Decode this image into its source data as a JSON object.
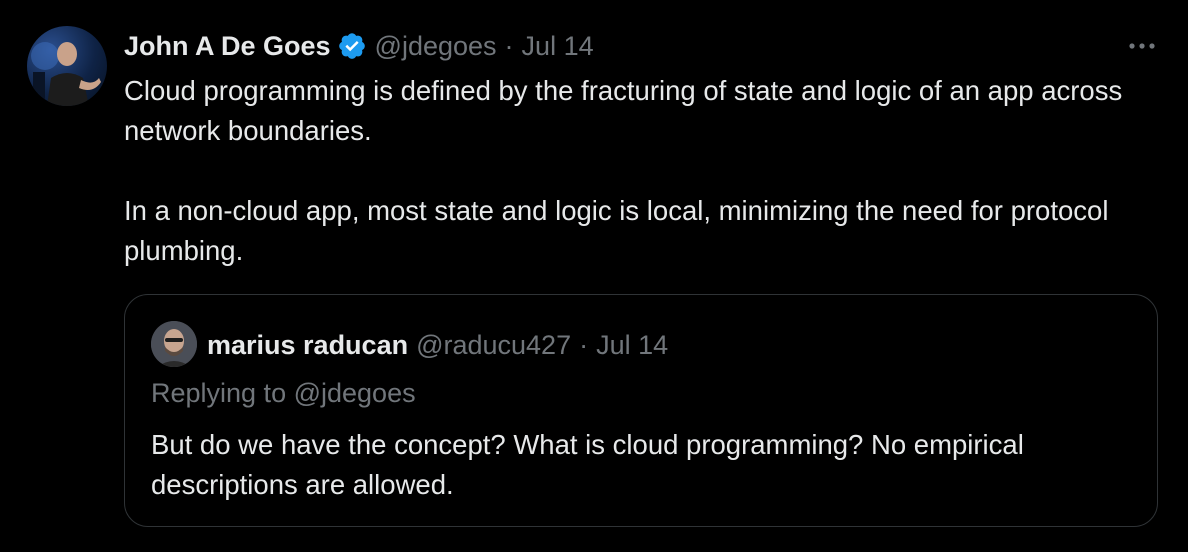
{
  "tweet": {
    "author": {
      "name": "John A De Goes",
      "handle": "@jdegoes",
      "verified": true
    },
    "separator": "·",
    "date": "Jul 14",
    "more_icon": "ellipsis-icon",
    "paragraphs": [
      "Cloud programming is defined by the fracturing of state and logic of an app across network boundaries.",
      "In a non-cloud app, most state and logic is local, minimizing the need for protocol plumbing."
    ],
    "quoted": {
      "author": {
        "name": "marius raducan",
        "handle": "@raducu427"
      },
      "separator": "·",
      "date": "Jul 14",
      "replying_prefix": "Replying to ",
      "replying_to": "@jdegoes",
      "text": "But do we have the concept? What is cloud programming? No empirical descriptions are allowed."
    }
  },
  "colors": {
    "background": "#000000",
    "primary_text": "#e7e9ea",
    "secondary_text": "#71767b",
    "verified_blue": "#1d9bf0",
    "border": "#2f3336"
  }
}
